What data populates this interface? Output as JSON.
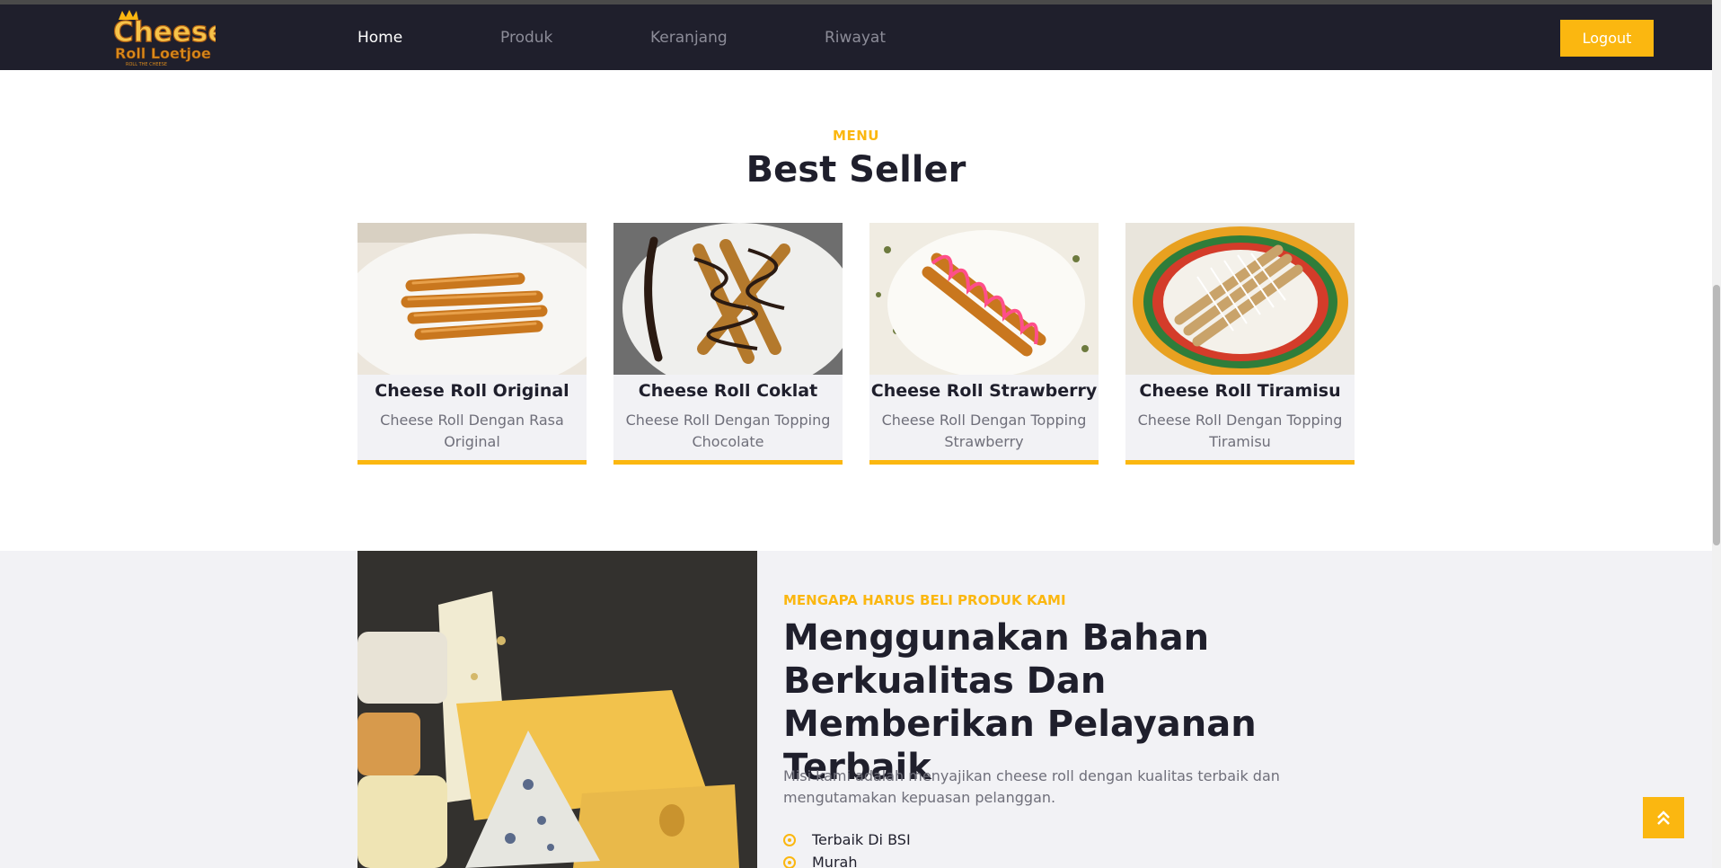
{
  "brand": {
    "logo_line1": "Cheese",
    "logo_line2": "Roll Loetjoe",
    "logo_tagline": "ROLL THE CHEESE"
  },
  "nav": {
    "items": [
      {
        "label": "Home",
        "active": true
      },
      {
        "label": "Produk",
        "active": false
      },
      {
        "label": "Keranjang",
        "active": false
      },
      {
        "label": "Riwayat",
        "active": false
      }
    ],
    "logout_label": "Logout"
  },
  "menu_section": {
    "label": "MENU",
    "title": "Best Seller",
    "cards": [
      {
        "title": "Cheese Roll Original",
        "description": "Cheese Roll Dengan Rasa Original"
      },
      {
        "title": "Cheese Roll Coklat",
        "description": "Cheese Roll Dengan Topping Chocolate"
      },
      {
        "title": "Cheese Roll Strawberry",
        "description": "Cheese Roll Dengan Topping Strawberry"
      },
      {
        "title": "Cheese Roll Tiramisu",
        "description": "Cheese Roll Dengan Topping Tiramisu"
      }
    ]
  },
  "why_section": {
    "label": "MENGAPA HARUS BELI PRODUK KAMI",
    "title": "Menggunakan Bahan Berkualitas Dan Memberikan Pelayanan Terbaik",
    "description": "Misi kami adalah menyajikan cheese roll dengan kualitas terbaik dan mengutamakan kepuasan pelanggan.",
    "features": [
      "Terbaik Di BSI",
      "Murah"
    ]
  },
  "icons": {
    "back_to_top": "double-chevron-up-icon",
    "feature_bullet": "circle-dot-icon"
  },
  "colors": {
    "accent": "#fbb710",
    "navbar": "#1f1f2c",
    "section_bg": "#f2f2f5"
  }
}
